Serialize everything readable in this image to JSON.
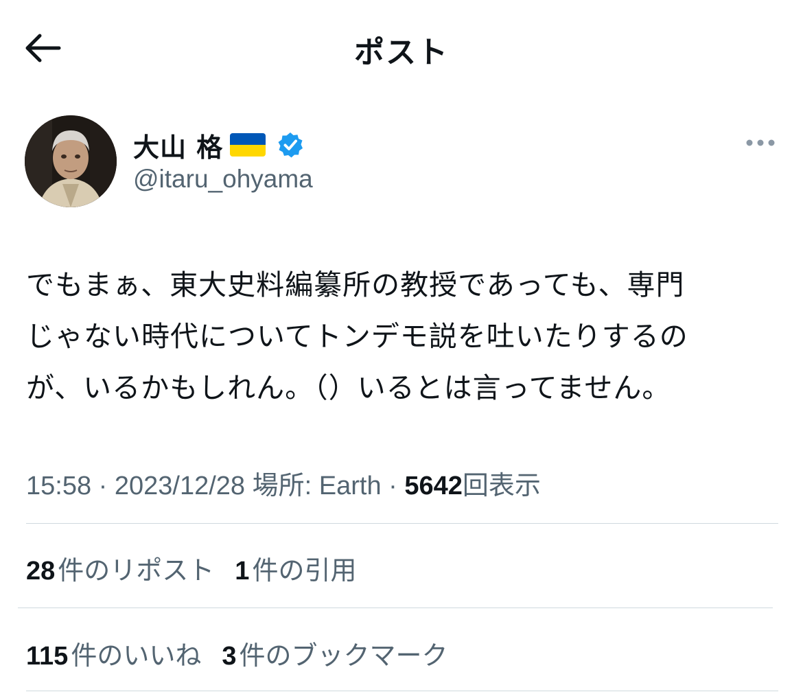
{
  "header": {
    "title": "ポスト",
    "back_icon": "arrow-left-icon"
  },
  "author": {
    "display_name": "大山 格",
    "flag_icon": "ukraine-flag-icon",
    "verified_icon": "verified-badge-icon",
    "handle": "@itaru_ohyama",
    "more_icon": "more-horizontal-icon"
  },
  "post": {
    "text": "でもまぁ、東大史料編纂所の教授であっても、専門\nじゃない時代についてトンデモ説を吐いたりするの\nが、いるかもしれん。（）いるとは言ってません。"
  },
  "meta": {
    "time": "15:58",
    "separator_1": "·",
    "date": "2023/12/28",
    "location_label": "場所:",
    "location_value": "Earth",
    "separator_2": "·",
    "views_count": "5642",
    "views_label": "回表示"
  },
  "stats": {
    "reposts_count": "28",
    "reposts_label": "件のリポスト",
    "quotes_count": "1",
    "quotes_label": "件の引用",
    "likes_count": "115",
    "likes_label": "件のいいね",
    "bookmarks_count": "3",
    "bookmarks_label": "件のブックマーク"
  },
  "colors": {
    "text_primary": "#0f1419",
    "text_secondary": "#536471",
    "verified_blue": "#1d9bf0",
    "divider": "#cfd9de",
    "flag_blue": "#0057b7",
    "flag_yellow": "#ffd700"
  }
}
